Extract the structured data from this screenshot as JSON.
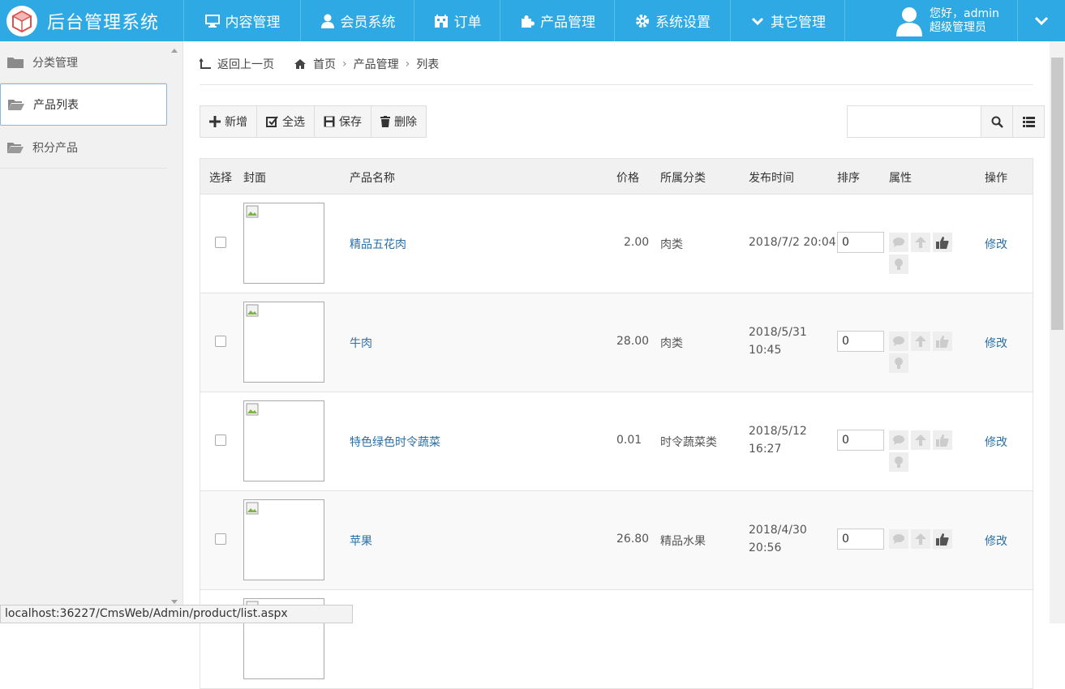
{
  "header": {
    "app_title": "后台管理系统",
    "nav": [
      {
        "label": "内容管理",
        "icon": "monitor-icon"
      },
      {
        "label": "会员系统",
        "icon": "user-icon"
      },
      {
        "label": "订单",
        "icon": "building-icon"
      },
      {
        "label": "产品管理",
        "icon": "puzzle-icon"
      },
      {
        "label": "系统设置",
        "icon": "gear-icon"
      },
      {
        "label": "其它管理",
        "icon": "chevron-down-icon"
      }
    ],
    "user_greeting": "您好，admin",
    "user_role": "超级管理员",
    "accent_color": "#2fa9e3"
  },
  "sidebar": {
    "items": [
      {
        "label": "分类管理",
        "icon": "folder-icon",
        "active": false
      },
      {
        "label": "产品列表",
        "icon": "folder-open-icon",
        "active": true
      },
      {
        "label": "积分产品",
        "icon": "folder-icon",
        "active": false
      }
    ]
  },
  "breadcrumb": {
    "back": "返回上一页",
    "home": "首页",
    "section": "产品管理",
    "page": "列表"
  },
  "toolbar": {
    "add": "新增",
    "select_all": "全选",
    "save": "保存",
    "delete": "删除"
  },
  "search": {
    "value": "",
    "placeholder": ""
  },
  "table": {
    "headers": {
      "select": "选择",
      "cover": "封面",
      "name": "产品名称",
      "price": "价格",
      "category": "所属分类",
      "published": "发布时间",
      "order": "排序",
      "attributes": "属性",
      "actions": "操作"
    },
    "rows": [
      {
        "name": "精品五花肉",
        "price": "2.00",
        "category": "肉类",
        "date_line1": "2018/7/2 20:04",
        "date_line2": "",
        "order": "0",
        "recommend_on": true,
        "action": "修改"
      },
      {
        "name": "牛肉",
        "price": "28.00",
        "category": "肉类",
        "date_line1": "2018/5/31",
        "date_line2": "10:45",
        "order": "0",
        "recommend_on": false,
        "action": "修改"
      },
      {
        "name": "特色绿色时令蔬菜",
        "price": "0.01",
        "category": "时令蔬菜类",
        "date_line1": "2018/5/12",
        "date_line2": "16:27",
        "order": "0",
        "recommend_on": false,
        "action": "修改"
      },
      {
        "name": "苹果",
        "price": "26.80",
        "category": "精品水果",
        "date_line1": "2018/4/30",
        "date_line2": "20:56",
        "order": "0",
        "recommend_on": true,
        "action": "修改"
      }
    ]
  },
  "statusbar": {
    "url": "localhost:36227/CmsWeb/Admin/product/list.aspx"
  }
}
